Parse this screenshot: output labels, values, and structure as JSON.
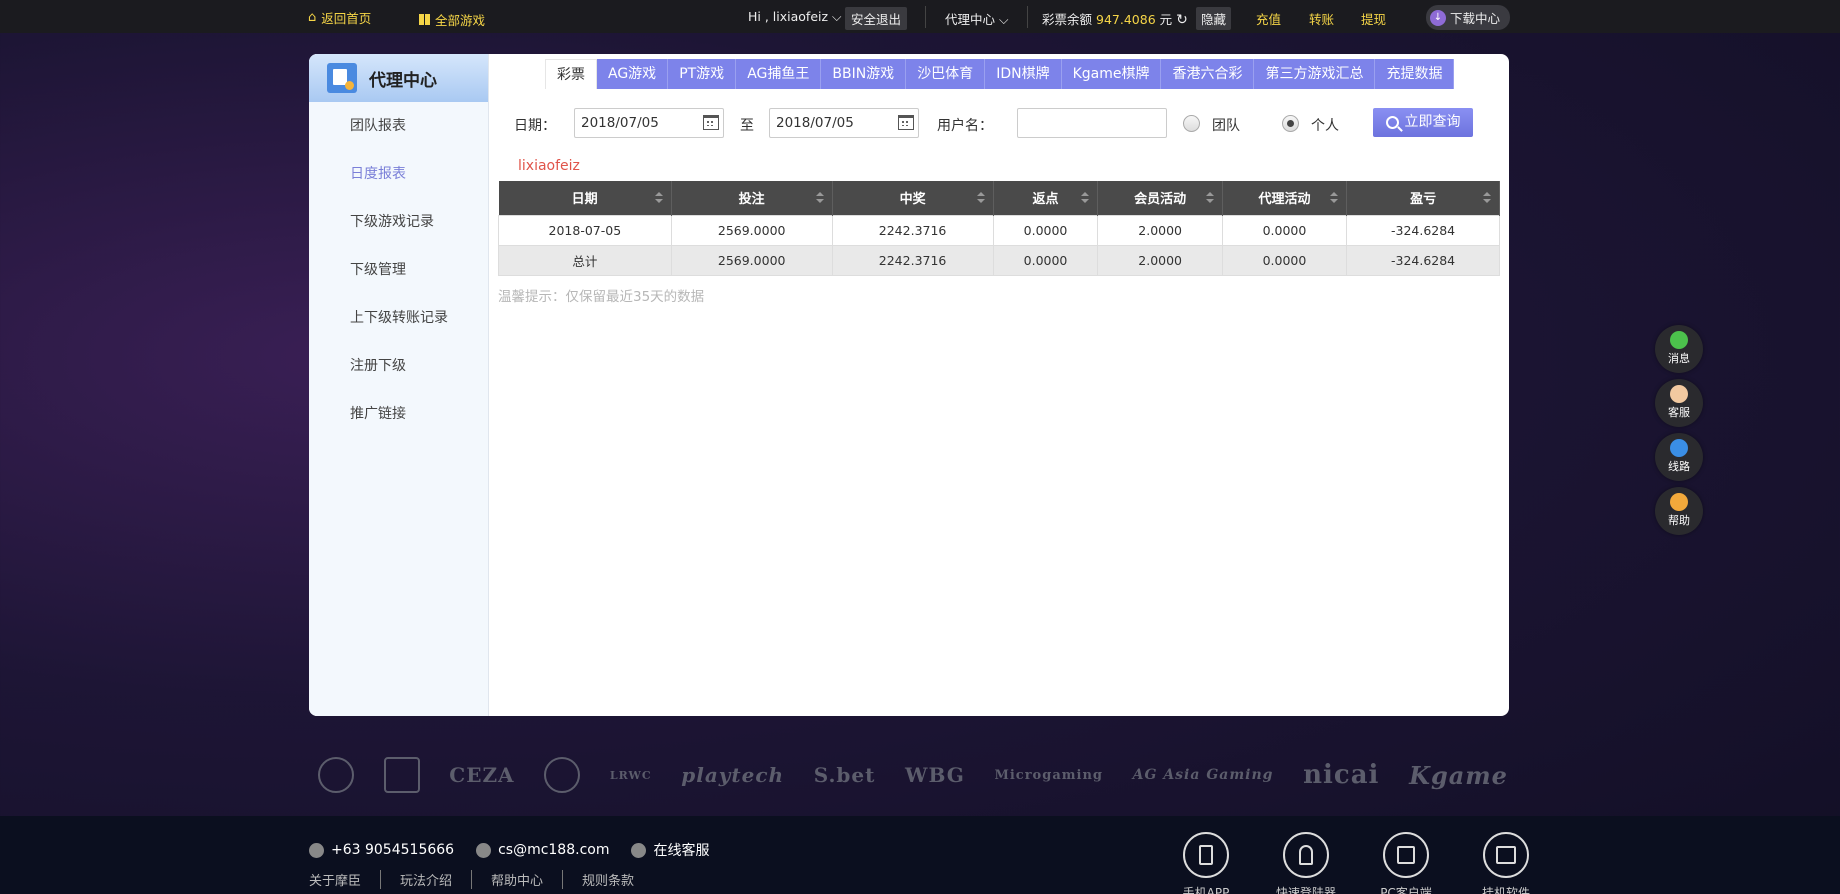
{
  "topbar": {
    "home_label": "返回首页",
    "all_games_label": "全部游戏",
    "greeting": "Hi , lixiaofeiz",
    "logout_label": "安全退出",
    "agent_label": "代理中心",
    "balance_label": "彩票余额",
    "balance_value": "947.4086",
    "balance_unit": "元",
    "hide_label": "隐藏",
    "recharge_label": "充值",
    "transfer_label": "转账",
    "withdraw_label": "提现",
    "download_label": "下载中心"
  },
  "sidebar": {
    "title": "代理中心",
    "items": [
      {
        "label": "团队报表"
      },
      {
        "label": "日度报表"
      },
      {
        "label": "下级游戏记录"
      },
      {
        "label": "下级管理"
      },
      {
        "label": "上下级转账记录"
      },
      {
        "label": "注册下级"
      },
      {
        "label": "推广链接"
      }
    ]
  },
  "tabs": [
    {
      "label": "彩票"
    },
    {
      "label": "AG游戏"
    },
    {
      "label": "PT游戏"
    },
    {
      "label": "AG捕鱼王"
    },
    {
      "label": "BBIN游戏"
    },
    {
      "label": "沙巴体育"
    },
    {
      "label": "IDN棋牌"
    },
    {
      "label": "Kgame棋牌"
    },
    {
      "label": "香港六合彩"
    },
    {
      "label": "第三方游戏汇总"
    },
    {
      "label": "充提数据"
    }
  ],
  "filters": {
    "date_label": "日期：",
    "date_from": "2018/07/05",
    "to_label": "至",
    "date_to": "2018/07/05",
    "username_label": "用户名：",
    "username_value": "",
    "team_label": "团队",
    "personal_label": "个人",
    "query_label": "立即查询"
  },
  "report": {
    "username": "lixiaofeiz",
    "columns": [
      "日期",
      "投注",
      "中奖",
      "返点",
      "会员活动",
      "代理活动",
      "盈亏"
    ],
    "rows": [
      [
        "2018-07-05",
        "2569.0000",
        "2242.3716",
        "0.0000",
        "2.0000",
        "0.0000",
        "-324.6284"
      ]
    ],
    "total": [
      "总计",
      "2569.0000",
      "2242.3716",
      "0.0000",
      "2.0000",
      "0.0000",
      "-324.6284"
    ],
    "tip": "温馨提示：仅保留最近35天的数据"
  },
  "floaters": [
    {
      "label": "消息",
      "color": "#4cc24c"
    },
    {
      "label": "客服",
      "color": "#f2c9a0"
    },
    {
      "label": "线路",
      "color": "#3a8ee6"
    },
    {
      "label": "帮助",
      "color": "#f2a93b"
    }
  ],
  "logos": [
    "CEZA",
    "playtech",
    "S.bet",
    "WBG",
    "Microgaming",
    "AG Asia Gaming",
    "nicai",
    "Kgame"
  ],
  "footer": {
    "phone": "+63 9054515666",
    "email": "cs@mc188.com",
    "online_service": "在线客服",
    "links": [
      "关于摩臣",
      "玩法介绍",
      "帮助中心",
      "规则条款"
    ],
    "apps": [
      {
        "label": "手机APP"
      },
      {
        "label": "快速登陆器"
      },
      {
        "label": "PC客户端"
      },
      {
        "label": "挂机软件"
      }
    ]
  }
}
